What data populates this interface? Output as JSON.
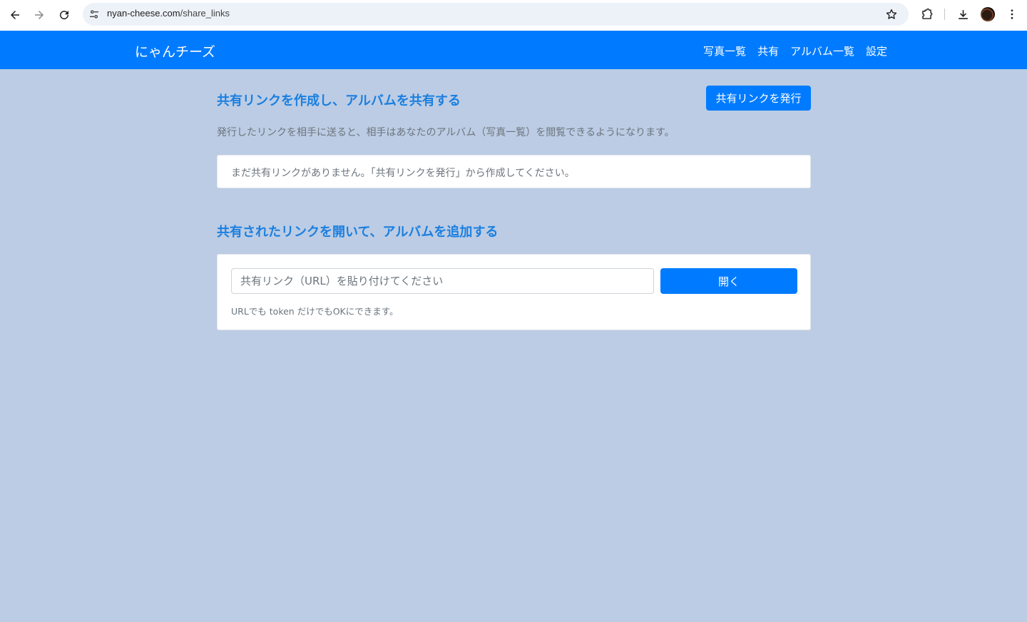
{
  "browser": {
    "url_host": "nyan-cheese.com",
    "url_path": "/share_links",
    "icons": {
      "back": "back-arrow-icon",
      "forward": "forward-arrow-icon",
      "reload": "reload-icon",
      "site_info": "tune-icon",
      "bookmark": "star-icon",
      "extensions": "puzzle-icon",
      "downloads": "download-icon",
      "menu": "more-vert-icon"
    }
  },
  "navbar": {
    "brand": "にゃんチーズ",
    "links": [
      "写真一覧",
      "共有",
      "アルバム一覧",
      "設定"
    ],
    "color": "#007bff"
  },
  "create_section": {
    "title": "共有リンクを作成し、アルバムを共有する",
    "button_label": "共有リンクを発行",
    "description": "発行したリンクを相手に送ると、相手はあなたのアルバム（写真一覧）を閲覧できるようになります。",
    "empty_message": "まだ共有リンクがありません。「共有リンクを発行」から作成してください。"
  },
  "open_section": {
    "title": "共有されたリンクを開いて、アルバムを追加する",
    "input_placeholder": "共有リンク（URL）を貼り付けてください",
    "input_value": "",
    "button_label": "開く",
    "help_text": "URLでも token だけでもOKにできます。"
  },
  "colors": {
    "page_background": "#bccce4",
    "accent": "#007bff",
    "heading": "#1a7fe0"
  }
}
